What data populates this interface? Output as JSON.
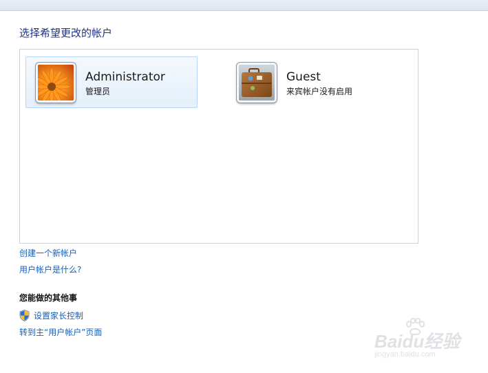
{
  "page": {
    "title": "选择希望更改的帐户"
  },
  "accounts": [
    {
      "name": "Administrator",
      "status": "管理员",
      "avatar_icon": "flower-avatar-icon",
      "selected": true
    },
    {
      "name": "Guest",
      "status": "来宾帐户没有启用",
      "avatar_icon": "suitcase-avatar-icon",
      "selected": false
    }
  ],
  "links": {
    "create_account": "创建一个新帐户",
    "what_is_account": "用户帐户是什么?"
  },
  "other_tasks": {
    "heading": "您能做的其他事",
    "parental_controls": {
      "label": "设置家长控制",
      "icon": "uac-shield-icon"
    },
    "go_main": "转到主“用户帐户”页面"
  },
  "watermark": {
    "logo_text": "Baidu经验",
    "url": "jingyan.baidu.com"
  },
  "colors": {
    "link": "#1a5fb4",
    "title": "#1e3287",
    "selection_fill": "#e5f0fb",
    "selection_border": "#b8d6fb"
  }
}
